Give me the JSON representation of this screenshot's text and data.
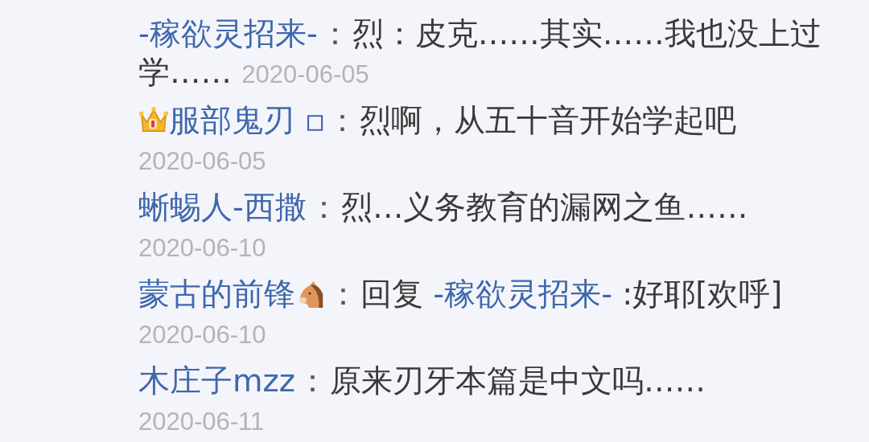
{
  "comments": [
    {
      "kind": "plain",
      "name": "-稼欲灵招来-",
      "leading_badge": false,
      "trailing_emoji": false,
      "colon": "：",
      "text": "烈：皮克……其实……我也没上过学……",
      "date": "2020-06-05"
    },
    {
      "kind": "plain",
      "name": "服部鬼刃 ▫",
      "leading_badge": true,
      "trailing_emoji": false,
      "colon": "：",
      "text": "烈啊，从五十音开始学起吧",
      "date": "2020-06-05"
    },
    {
      "kind": "plain",
      "name": "蜥蜴人-西撒",
      "leading_badge": false,
      "trailing_emoji": false,
      "colon": "：",
      "text": "烈…义务教育的漏网之鱼……",
      "date": "2020-06-10"
    },
    {
      "kind": "reply",
      "name": "蒙古的前锋",
      "leading_badge": false,
      "trailing_emoji": true,
      "colon": "：",
      "reply_prefix": "回复",
      "reply_to": "-稼欲灵招来-",
      "text": ":好耶[欢呼]",
      "date": "2020-06-10"
    },
    {
      "kind": "plain",
      "name": "木庄子mzz",
      "leading_badge": false,
      "trailing_emoji": false,
      "colon": "：",
      "text": "原来刃牙本篇是中文吗……",
      "date": "2020-06-11"
    }
  ]
}
